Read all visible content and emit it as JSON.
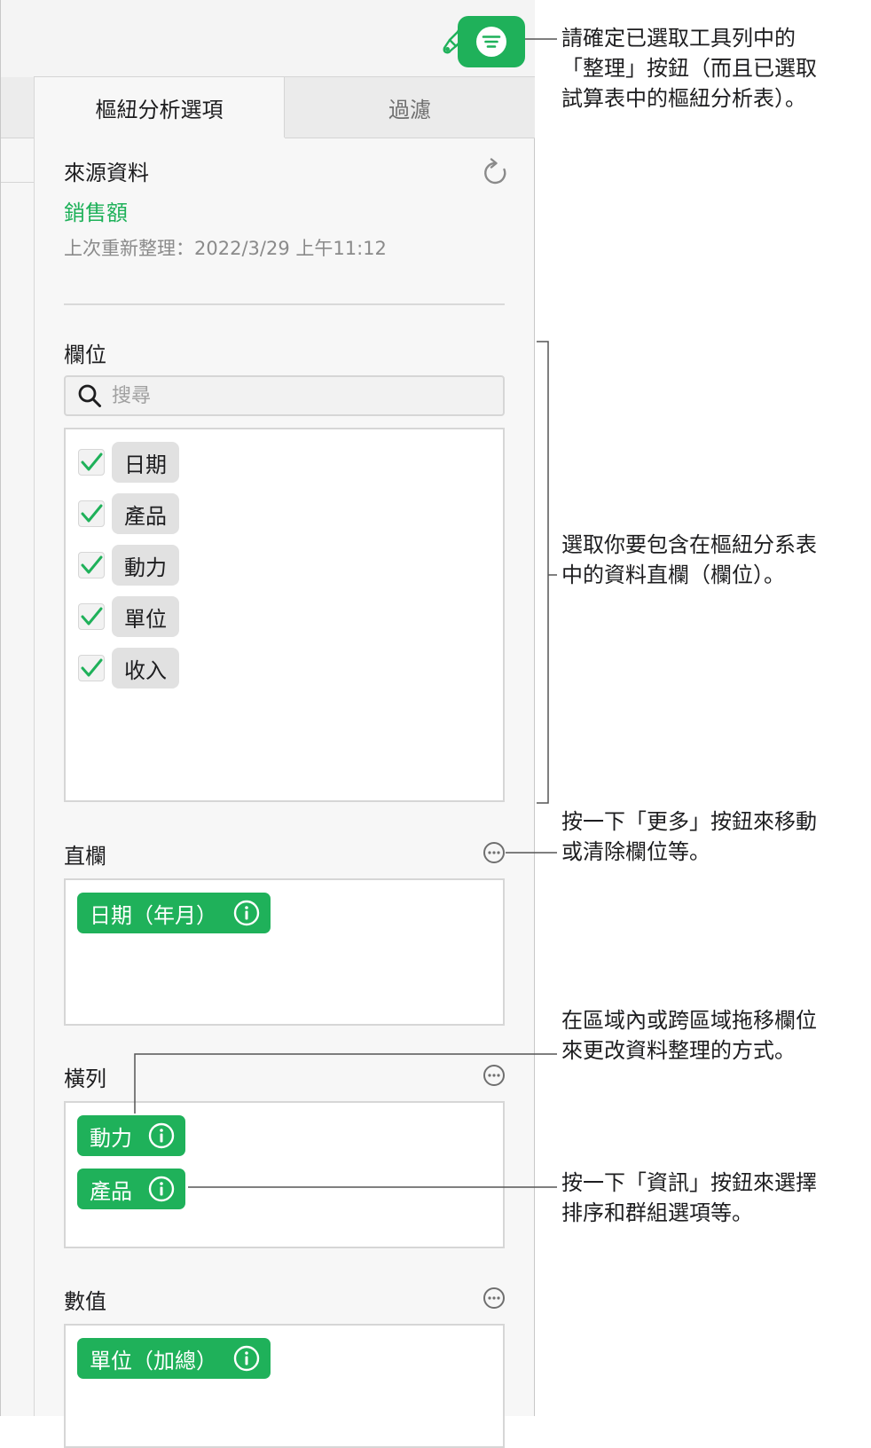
{
  "toolbar": {
    "format_icon": "paintbrush-icon",
    "organize_icon": "organize-lines-icon"
  },
  "sidebar": {
    "tabs": [
      {
        "label": "樞紐分析選項",
        "active": true
      },
      {
        "label": "過濾",
        "active": false
      }
    ],
    "source": {
      "title": "來源資料",
      "name": "銷售額",
      "last_refresh": "上次重新整理：2022/3/29 上午11:12",
      "refresh_icon": "refresh-icon"
    },
    "fields": {
      "title": "欄位",
      "search_placeholder": "搜尋",
      "items": [
        {
          "label": "日期",
          "checked": true
        },
        {
          "label": "產品",
          "checked": true
        },
        {
          "label": "動力",
          "checked": true
        },
        {
          "label": "單位",
          "checked": true
        },
        {
          "label": "收入",
          "checked": true
        }
      ]
    },
    "columns": {
      "title": "直欄",
      "items": [
        {
          "label": "日期（年月）"
        }
      ]
    },
    "rows": {
      "title": "橫列",
      "items": [
        {
          "label": "動力"
        },
        {
          "label": "產品"
        }
      ]
    },
    "values": {
      "title": "數值",
      "items": [
        {
          "label": "單位（加總）"
        }
      ]
    }
  },
  "callouts": {
    "organize": [
      "請確定已選取工具列中的",
      "「整理」按鈕（而且已選取",
      "試算表中的樞紐分析表）。"
    ],
    "fields": [
      "選取你要包含在樞紐分系表",
      "中的資料直欄（欄位）。"
    ],
    "more": [
      "按一下「更多」按鈕來移動",
      "或清除欄位等。"
    ],
    "drag": [
      "在區域內或跨區域拖移欄位",
      "來更改資料整理的方式。"
    ],
    "info": [
      "按一下「資訊」按鈕來選擇",
      "排序和群組選項等。"
    ]
  },
  "colors": {
    "accent": "#1fb15a",
    "panel_bg": "#f7f7f7",
    "pill_bg": "#e1e1e1"
  }
}
